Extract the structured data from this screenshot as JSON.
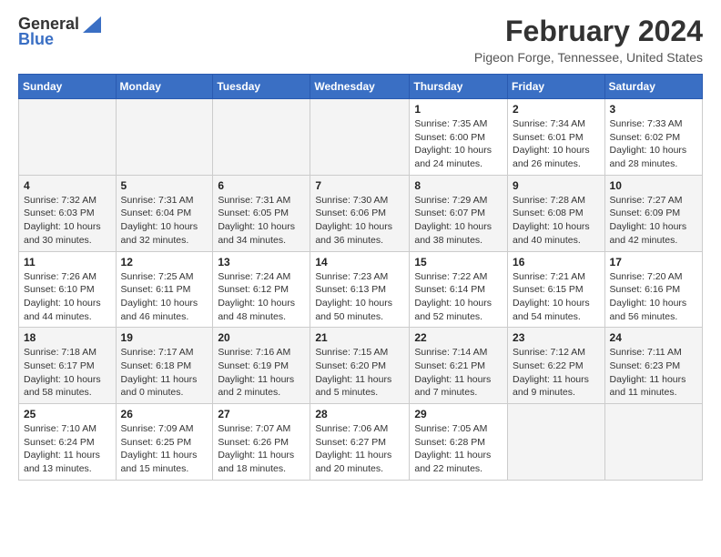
{
  "app": {
    "logo_general": "General",
    "logo_blue": "Blue"
  },
  "header": {
    "month": "February 2024",
    "location": "Pigeon Forge, Tennessee, United States"
  },
  "weekdays": [
    "Sunday",
    "Monday",
    "Tuesday",
    "Wednesday",
    "Thursday",
    "Friday",
    "Saturday"
  ],
  "weeks": [
    [
      {
        "day": "",
        "info": ""
      },
      {
        "day": "",
        "info": ""
      },
      {
        "day": "",
        "info": ""
      },
      {
        "day": "",
        "info": ""
      },
      {
        "day": "1",
        "info": "Sunrise: 7:35 AM\nSunset: 6:00 PM\nDaylight: 10 hours and 24 minutes."
      },
      {
        "day": "2",
        "info": "Sunrise: 7:34 AM\nSunset: 6:01 PM\nDaylight: 10 hours and 26 minutes."
      },
      {
        "day": "3",
        "info": "Sunrise: 7:33 AM\nSunset: 6:02 PM\nDaylight: 10 hours and 28 minutes."
      }
    ],
    [
      {
        "day": "4",
        "info": "Sunrise: 7:32 AM\nSunset: 6:03 PM\nDaylight: 10 hours and 30 minutes."
      },
      {
        "day": "5",
        "info": "Sunrise: 7:31 AM\nSunset: 6:04 PM\nDaylight: 10 hours and 32 minutes."
      },
      {
        "day": "6",
        "info": "Sunrise: 7:31 AM\nSunset: 6:05 PM\nDaylight: 10 hours and 34 minutes."
      },
      {
        "day": "7",
        "info": "Sunrise: 7:30 AM\nSunset: 6:06 PM\nDaylight: 10 hours and 36 minutes."
      },
      {
        "day": "8",
        "info": "Sunrise: 7:29 AM\nSunset: 6:07 PM\nDaylight: 10 hours and 38 minutes."
      },
      {
        "day": "9",
        "info": "Sunrise: 7:28 AM\nSunset: 6:08 PM\nDaylight: 10 hours and 40 minutes."
      },
      {
        "day": "10",
        "info": "Sunrise: 7:27 AM\nSunset: 6:09 PM\nDaylight: 10 hours and 42 minutes."
      }
    ],
    [
      {
        "day": "11",
        "info": "Sunrise: 7:26 AM\nSunset: 6:10 PM\nDaylight: 10 hours and 44 minutes."
      },
      {
        "day": "12",
        "info": "Sunrise: 7:25 AM\nSunset: 6:11 PM\nDaylight: 10 hours and 46 minutes."
      },
      {
        "day": "13",
        "info": "Sunrise: 7:24 AM\nSunset: 6:12 PM\nDaylight: 10 hours and 48 minutes."
      },
      {
        "day": "14",
        "info": "Sunrise: 7:23 AM\nSunset: 6:13 PM\nDaylight: 10 hours and 50 minutes."
      },
      {
        "day": "15",
        "info": "Sunrise: 7:22 AM\nSunset: 6:14 PM\nDaylight: 10 hours and 52 minutes."
      },
      {
        "day": "16",
        "info": "Sunrise: 7:21 AM\nSunset: 6:15 PM\nDaylight: 10 hours and 54 minutes."
      },
      {
        "day": "17",
        "info": "Sunrise: 7:20 AM\nSunset: 6:16 PM\nDaylight: 10 hours and 56 minutes."
      }
    ],
    [
      {
        "day": "18",
        "info": "Sunrise: 7:18 AM\nSunset: 6:17 PM\nDaylight: 10 hours and 58 minutes."
      },
      {
        "day": "19",
        "info": "Sunrise: 7:17 AM\nSunset: 6:18 PM\nDaylight: 11 hours and 0 minutes."
      },
      {
        "day": "20",
        "info": "Sunrise: 7:16 AM\nSunset: 6:19 PM\nDaylight: 11 hours and 2 minutes."
      },
      {
        "day": "21",
        "info": "Sunrise: 7:15 AM\nSunset: 6:20 PM\nDaylight: 11 hours and 5 minutes."
      },
      {
        "day": "22",
        "info": "Sunrise: 7:14 AM\nSunset: 6:21 PM\nDaylight: 11 hours and 7 minutes."
      },
      {
        "day": "23",
        "info": "Sunrise: 7:12 AM\nSunset: 6:22 PM\nDaylight: 11 hours and 9 minutes."
      },
      {
        "day": "24",
        "info": "Sunrise: 7:11 AM\nSunset: 6:23 PM\nDaylight: 11 hours and 11 minutes."
      }
    ],
    [
      {
        "day": "25",
        "info": "Sunrise: 7:10 AM\nSunset: 6:24 PM\nDaylight: 11 hours and 13 minutes."
      },
      {
        "day": "26",
        "info": "Sunrise: 7:09 AM\nSunset: 6:25 PM\nDaylight: 11 hours and 15 minutes."
      },
      {
        "day": "27",
        "info": "Sunrise: 7:07 AM\nSunset: 6:26 PM\nDaylight: 11 hours and 18 minutes."
      },
      {
        "day": "28",
        "info": "Sunrise: 7:06 AM\nSunset: 6:27 PM\nDaylight: 11 hours and 20 minutes."
      },
      {
        "day": "29",
        "info": "Sunrise: 7:05 AM\nSunset: 6:28 PM\nDaylight: 11 hours and 22 minutes."
      },
      {
        "day": "",
        "info": ""
      },
      {
        "day": "",
        "info": ""
      }
    ]
  ]
}
